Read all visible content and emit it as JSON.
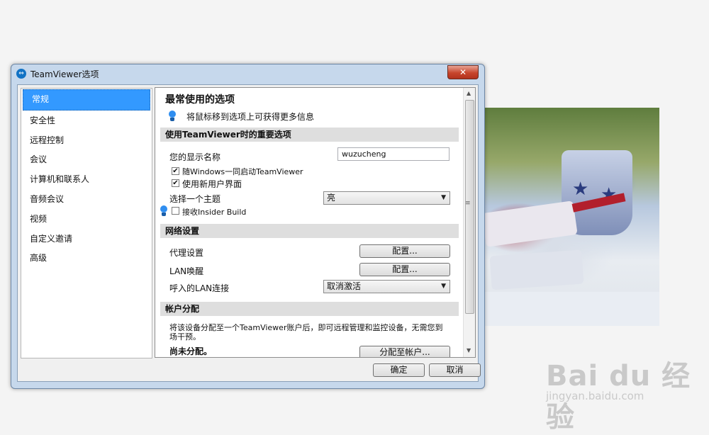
{
  "window": {
    "title": "TeamViewer选项",
    "close_glyph": "✕"
  },
  "sidebar": {
    "items": [
      {
        "label": "常规",
        "active": true
      },
      {
        "label": "安全性"
      },
      {
        "label": "远程控制"
      },
      {
        "label": "会议"
      },
      {
        "label": "计算机和联系人"
      },
      {
        "label": "音频会议"
      },
      {
        "label": "视频"
      },
      {
        "label": "自定义邀请"
      },
      {
        "label": "高级"
      }
    ]
  },
  "main": {
    "heading": "最常使用的选项",
    "hint": "将鼠标移到选项上可获得更多信息",
    "section_important": {
      "title": "使用TeamViewer时的重要选项",
      "display_name_label": "您的显示名称",
      "display_name_value": "wuzucheng",
      "startup_with_windows": {
        "label": "随Windows一同启动TeamViewer",
        "checked": true
      },
      "new_ui": {
        "label": "使用新用户界面",
        "checked": true
      },
      "theme_label": "选择一个主题",
      "theme_value": "亮",
      "insider": {
        "label": "接收Insider Build",
        "checked": false
      }
    },
    "section_network": {
      "title": "网络设置",
      "proxy_label": "代理设置",
      "proxy_button": "配置...",
      "lan_wake_label": "LAN唤醒",
      "lan_wake_button": "配置...",
      "incoming_lan_label": "呼入的LAN连接",
      "incoming_lan_value": "取消激活"
    },
    "section_account": {
      "title": "帐户分配",
      "description": "将该设备分配至一个TeamViewer账户后，即可远程管理和监控设备，无需您到场干预。",
      "status": "尚未分配。",
      "assign_button": "分配至帐户..."
    }
  },
  "footer": {
    "ok": "确定",
    "cancel": "取消"
  },
  "scrollbar": {
    "up": "▲",
    "down": "▼",
    "grip": "≡"
  },
  "watermark": {
    "brand": "Bai du 经验",
    "url": "jingyan.baidu.com"
  },
  "colors": {
    "selection": "#3399ff",
    "close_button": "#c7452c",
    "bulb": "#2f8ef0"
  },
  "icons": [
    "teamviewer-logo-icon",
    "close-icon",
    "lightbulb-icon",
    "checkbox-icon",
    "dropdown-caret-icon",
    "scroll-arrow-icon"
  ]
}
